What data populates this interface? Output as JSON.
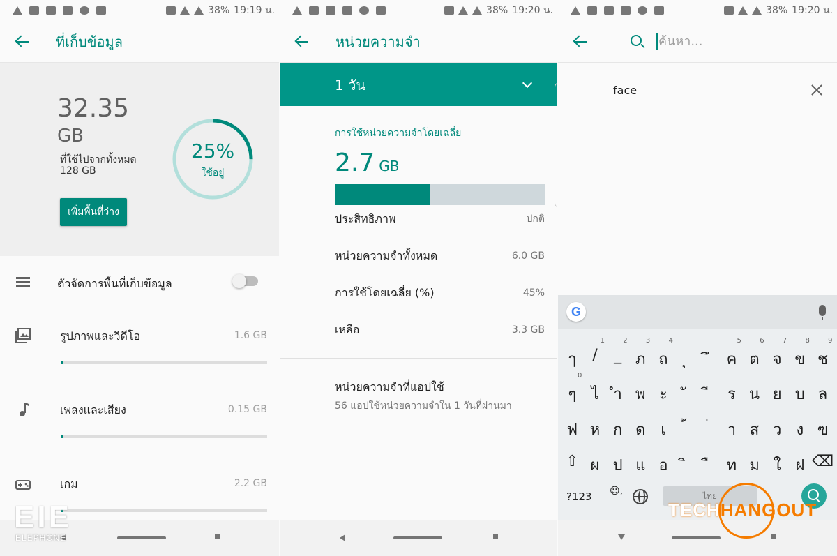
{
  "status_bar": [
    {
      "battery": "38%",
      "time": "19:19 น."
    },
    {
      "battery": "38%",
      "time": "19:20 น."
    },
    {
      "battery": "38%",
      "time": "19:20 น."
    }
  ],
  "storage": {
    "title": "ที่เก็บข้อมูล",
    "used_value": "32.35",
    "used_unit": "GB",
    "used_label": "ที่ใช้ไปจากทั้งหมด",
    "total": "128 GB",
    "free_button": "เพิ่มพื้นที่ว่าง",
    "percent": "25%",
    "percent_label": "ใช้อยู่",
    "percent_fraction": 0.25,
    "manager_label": "ตัวจัดการพื้นที่เก็บข้อมูล",
    "manager_enabled": false,
    "categories": [
      {
        "label": "รูปภาพและวิดีโอ",
        "size": "1.6 GB",
        "fraction": 0.012,
        "icon": "photo-icon"
      },
      {
        "label": "เพลงและเสียง",
        "size": "0.15 GB",
        "fraction": 0.0,
        "icon": "music-note-icon"
      },
      {
        "label": "เกม",
        "size": "2.2 GB",
        "fraction": 0.0,
        "icon": "gamepad-icon"
      }
    ]
  },
  "memory": {
    "title": "หน่วยความจำ",
    "period": "1 วัน",
    "avg_label": "การใช้หน่วยความจำโดยเฉลี่ย",
    "avg_value": "2.7",
    "avg_unit": "GB",
    "avg_fraction": 0.45,
    "rows": [
      {
        "k": "ประสิทธิภาพ",
        "v": "ปกติ"
      },
      {
        "k": "หน่วยความจำทั้งหมด",
        "v": "6.0 GB"
      },
      {
        "k": "การใช้โดยเฉลี่ย (%)",
        "v": "45%"
      },
      {
        "k": "เหลือ",
        "v": "3.3 GB"
      }
    ],
    "apps_title": "หน่วยความจำที่แอปใช้",
    "apps_sub": "56 แอปใช้หน่วยความจำใน 1 วันที่ผ่านมา"
  },
  "search": {
    "placeholder": "ค้นหา...",
    "suggestion": "face",
    "keyboard": {
      "row1": [
        {
          "k": "ๅ",
          "n": ""
        },
        {
          "k": "/",
          "n": "1"
        },
        {
          "k": "_",
          "n": "2"
        },
        {
          "k": "ภ",
          "n": "3"
        },
        {
          "k": "ถ",
          "n": "4"
        },
        {
          "k": "ุ",
          "n": ""
        },
        {
          "k": "ึ",
          "n": ""
        },
        {
          "k": "ค",
          "n": "5"
        },
        {
          "k": "ต",
          "n": "6"
        },
        {
          "k": "จ",
          "n": "7"
        },
        {
          "k": "ข",
          "n": "8"
        },
        {
          "k": "ช",
          "n": "9"
        }
      ],
      "row2": [
        {
          "k": "ๆ",
          "n": "0"
        },
        {
          "k": "ไ",
          "n": ""
        },
        {
          "k": "ำ",
          "n": ""
        },
        {
          "k": "พ",
          "n": ""
        },
        {
          "k": "ะ",
          "n": ""
        },
        {
          "k": "ั",
          "n": ""
        },
        {
          "k": "ี",
          "n": ""
        },
        {
          "k": "ร",
          "n": ""
        },
        {
          "k": "น",
          "n": ""
        },
        {
          "k": "ย",
          "n": ""
        },
        {
          "k": "บ",
          "n": ""
        },
        {
          "k": "ล",
          "n": ""
        }
      ],
      "row3": [
        {
          "k": "ฟ",
          "n": ""
        },
        {
          "k": "ห",
          "n": ""
        },
        {
          "k": "ก",
          "n": ""
        },
        {
          "k": "ด",
          "n": ""
        },
        {
          "k": "เ",
          "n": ""
        },
        {
          "k": "้",
          "n": ""
        },
        {
          "k": "่",
          "n": ""
        },
        {
          "k": "า",
          "n": ""
        },
        {
          "k": "ส",
          "n": ""
        },
        {
          "k": "ว",
          "n": ""
        },
        {
          "k": "ง",
          "n": ""
        },
        {
          "k": "ฃ",
          "n": ""
        }
      ],
      "row4": [
        {
          "k": "⇧",
          "n": ""
        },
        {
          "k": "ผ",
          "n": ""
        },
        {
          "k": "ป",
          "n": ""
        },
        {
          "k": "แ",
          "n": ""
        },
        {
          "k": "อ",
          "n": ""
        },
        {
          "k": "ิ",
          "n": ""
        },
        {
          "k": "ื",
          "n": ""
        },
        {
          "k": "ท",
          "n": ""
        },
        {
          "k": "ม",
          "n": ""
        },
        {
          "k": "ใ",
          "n": ""
        },
        {
          "k": "ฝ",
          "n": ""
        },
        {
          "k": "⌫",
          "n": ""
        }
      ],
      "symbols_key": "?123",
      "emoji_key": "☺,",
      "space_label": "ไทย",
      "google_logo": "G"
    }
  },
  "watermarks": {
    "left_logo": "EIE",
    "left_sub": "ELEPHONE",
    "right_a": "TECH",
    "right_b": "HANGOUT"
  },
  "colors": {
    "accent": "#00897b",
    "teal": "#009688",
    "track": "#b2dfdb"
  }
}
